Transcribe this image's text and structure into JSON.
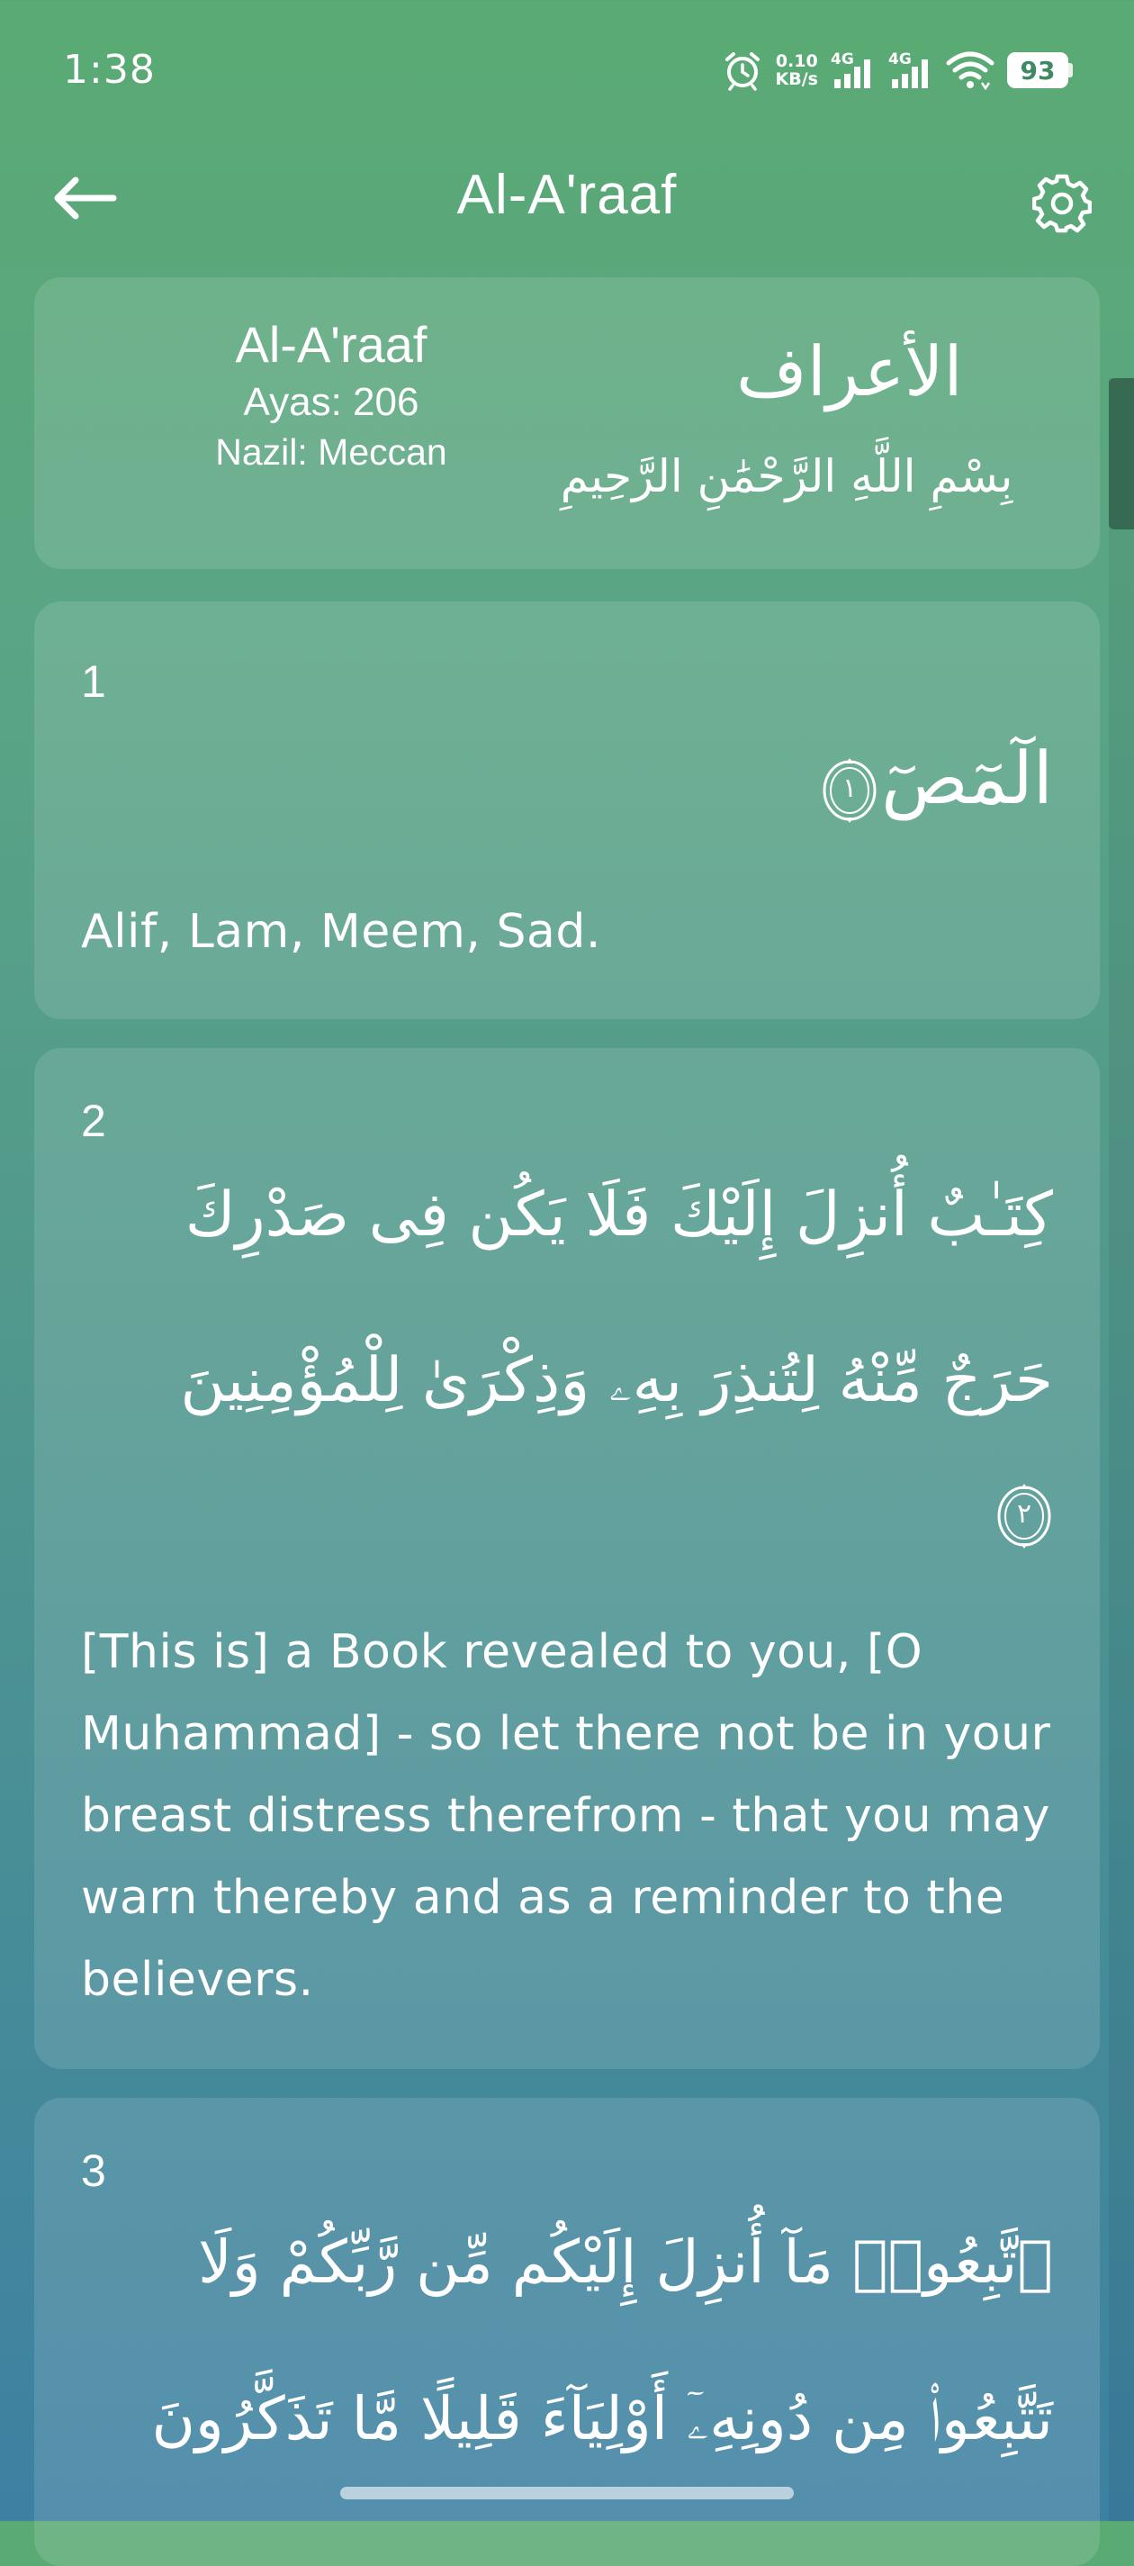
{
  "status_bar": {
    "time": "1:38",
    "net_speed_value": "0.10",
    "net_speed_unit": "KB/s",
    "signal_1_label": "4G",
    "signal_2_label": "4G",
    "battery": "93",
    "icons": [
      "alarm-icon",
      "signal-icon",
      "signal-icon",
      "wifi-icon",
      "battery-icon"
    ]
  },
  "app_bar": {
    "title": "Al-A'raaf",
    "back_icon": "arrow-left-icon",
    "settings_icon": "gear-icon"
  },
  "surah_header": {
    "name": "Al-A'raaf",
    "ayas": "Ayas: 206",
    "nazil": "Nazil: Meccan",
    "arabic_name": "الأعراف",
    "bismillah": "بِسْمِ اللَّهِ الرَّحْمَٰنِ الرَّحِيمِ"
  },
  "ayahs": [
    {
      "number": "1",
      "arabic_lines": [
        "الٓمٓصٓ"
      ],
      "marker": "١",
      "translation": "Alif, Lam, Meem, Sad."
    },
    {
      "number": "2",
      "arabic_lines": [
        "كِتَـٰبٌ أُنزِلَ إِلَيْكَ فَلَا يَكُن فِى صَدْرِكَ",
        "حَرَجٌ مِّنْهُ لِتُنذِرَ بِهِۦ وَذِكْرَىٰ لِلْمُؤْمِنِينَ"
      ],
      "marker": "٢",
      "translation": "[This is] a Book revealed to you, [O Muhammad] -  so let there not be in your breast distress therefrom -  that you may warn thereby and as a reminder to the believers."
    },
    {
      "number": "3",
      "arabic_lines": [
        "ٱتَّبِعُوا۟ مَآ أُنزِلَ إِلَيْكُم مِّن رَّبِّكُمْ وَلَا",
        "تَتَّبِعُوا۟ مِن دُونِهِۦٓ أَوْلِيَآءَ قَلِيلًا مَّا تَذَكَّرُونَ"
      ]
    }
  ],
  "colors": {
    "gradient_top": "#5aaa73",
    "gradient_bottom": "#3d80a2",
    "card_overlay": "rgba(255,255,255,0.12)",
    "scroll_thumb": "#2e5a46"
  }
}
